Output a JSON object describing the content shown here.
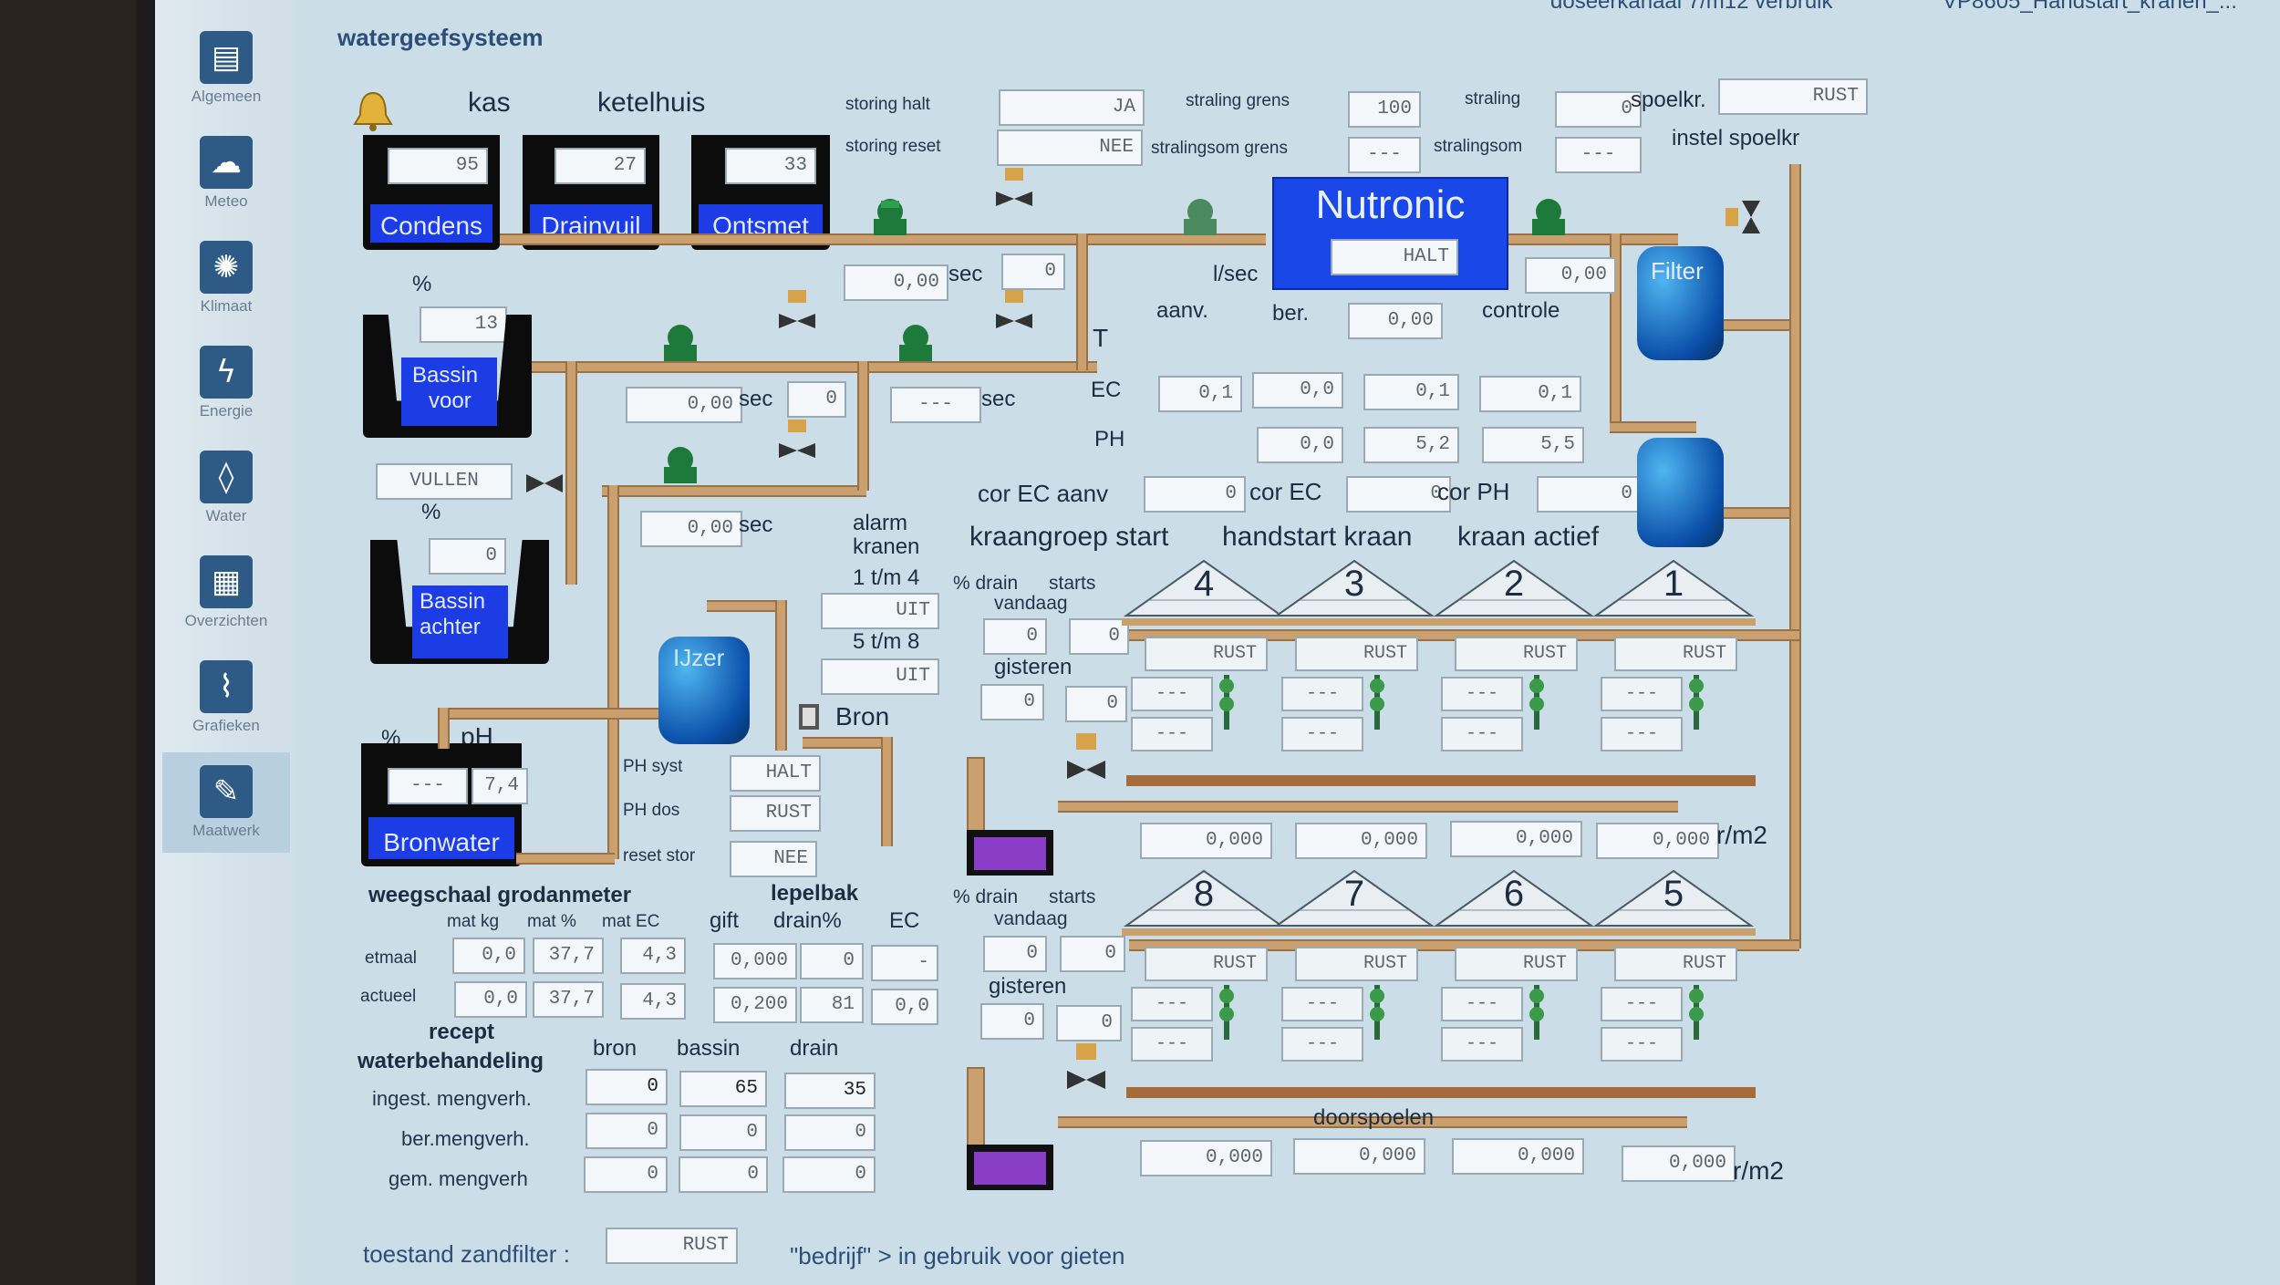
{
  "window": {
    "title": "watergeefsysteem",
    "top_right_text_1": "doseerkanaal 7/m12 verbruik",
    "top_right_text_2": "VP8605_Handstart_kranen_..."
  },
  "sidebar": {
    "items": [
      {
        "label": "Algemeen",
        "icon": "notebook-icon"
      },
      {
        "label": "Meteo",
        "icon": "cloud-icon"
      },
      {
        "label": "Klimaat",
        "icon": "sun-icon"
      },
      {
        "label": "Energie",
        "icon": "lightning-icon"
      },
      {
        "label": "Water",
        "icon": "droplet-icon"
      },
      {
        "label": "Overzichten",
        "icon": "chart-map-icon"
      },
      {
        "label": "Grafieken",
        "icon": "graph-icon"
      },
      {
        "label": "Maatwerk",
        "icon": "pencil-icon"
      }
    ]
  },
  "tanks": {
    "headers": {
      "kas": "kas",
      "ketelhuis": "ketelhuis"
    },
    "condens": {
      "name": "Condens",
      "value": "95"
    },
    "drainvuil": {
      "name": "Drainvuil",
      "value": "27"
    },
    "ontsmet": {
      "name": "Ontsmet",
      "value": "33"
    },
    "bassin_voor": {
      "name_line1": "Bassin",
      "name_line2": "voor",
      "pct_label": "%",
      "value": "13",
      "button": "VULLEN"
    },
    "bassin_achter": {
      "name_line1": "Bassin",
      "name_line2": "achter",
      "pct_label": "%",
      "value": "0"
    },
    "bronwater": {
      "name": "Bronwater",
      "pct_label": "%",
      "ph_label": "pH",
      "value": "---",
      "ph": "7,4"
    }
  },
  "storing": {
    "halt_label": "storing halt",
    "halt_value": "JA",
    "reset_label": "storing reset",
    "reset_value": "NEE"
  },
  "straling": {
    "grens_label": "straling grens",
    "grens_value": "100",
    "straling_label": "straling",
    "straling_value": "0",
    "som_grens_label": "stralingsom grens",
    "som_grens_value": "---",
    "som_label": "stralingsom",
    "som_value": "---",
    "spoelkr_label": "spoelkr.",
    "spoelkr_value": "RUST",
    "instel_label": "instel spoelkr"
  },
  "flows": {
    "f1": "0,00",
    "f1_unit": "sec",
    "f1_b": "0",
    "f2": "0,00",
    "f2_unit": "sec",
    "f2_b": "0",
    "f3": "---",
    "f3_unit": "sec",
    "f4": "0,00",
    "f4_unit": "sec",
    "lsec_label": "l/sec",
    "t_label": "T"
  },
  "nutronic": {
    "title": "Nutronic",
    "status": "HALT",
    "controle_value": "0,00",
    "controle_label": "controle",
    "aanv_label": "aanv.",
    "ber_label": "ber.",
    "ber_value": "0,00",
    "ec_label": "EC",
    "ph_label": "PH",
    "ec_aanv": "0,1",
    "ec_ber": "0,0",
    "ec_v1": "0,1",
    "ec_v2": "0,1",
    "ph_ber": "0,0",
    "ph_v1": "5,2",
    "ph_v2": "5,5",
    "cor_ec_aanv_label": "cor EC aanv",
    "cor_ec_aanv": "0",
    "cor_ec_label": "cor EC",
    "cor_ec": "0",
    "cor_ph_label": "cor PH",
    "cor_ph": "0",
    "filter_label": "Filter"
  },
  "alarm": {
    "label_line1": "alarm",
    "label_line2": "kranen",
    "k14_label": "1 t/m 4",
    "k14_value": "UIT",
    "k58_label": "5 t/m 8",
    "k58_value": "UIT"
  },
  "bron": {
    "ijzer_label": "IJzer",
    "bron_label": "Bron",
    "ph_syst_label": "PH syst",
    "ph_syst_value": "HALT",
    "ph_dos_label": "PH dos",
    "ph_dos_value": "RUST",
    "reset_stor_label": "reset stor",
    "reset_stor_value": "NEE"
  },
  "kraangroep": {
    "headers": {
      "start": "kraangroep start",
      "handstart": "handstart kraan",
      "actief": "kraan actief"
    },
    "top": {
      "drain_label": "% drain",
      "starts_label": "starts",
      "vandaag_label": "vandaag",
      "gisteren_label": "gisteren",
      "drain_vandaag": "0",
      "starts_vandaag": "0",
      "drain_gisteren": "0",
      "starts_gisteren": "0",
      "houses": [
        {
          "num": "4",
          "status": "RUST",
          "r1": "---",
          "r2": "---",
          "total": "0,000"
        },
        {
          "num": "3",
          "status": "RUST",
          "r1": "---",
          "r2": "---",
          "total": "0,000"
        },
        {
          "num": "2",
          "status": "RUST",
          "r1": "---",
          "r2": "---",
          "total": "0,000"
        },
        {
          "num": "1",
          "status": "RUST",
          "r1": "---",
          "r2": "---",
          "total": "0,000"
        }
      ],
      "unit": "r/m2"
    },
    "bottom": {
      "drain_label": "% drain",
      "starts_label": "starts",
      "vandaag_label": "vandaag",
      "gisteren_label": "gisteren",
      "drain_vandaag": "0",
      "starts_vandaag": "0",
      "drain_gisteren": "0",
      "starts_gisteren": "0",
      "houses": [
        {
          "num": "8",
          "status": "RUST",
          "r1": "---",
          "r2": "---",
          "total": "0,000"
        },
        {
          "num": "7",
          "status": "RUST",
          "r1": "---",
          "r2": "---",
          "total": "0,000"
        },
        {
          "num": "6",
          "status": "RUST",
          "r1": "---",
          "r2": "---",
          "total": "0,000"
        },
        {
          "num": "5",
          "status": "RUST",
          "r1": "---",
          "r2": "---",
          "total": "0,000"
        }
      ],
      "unit": "r/m2",
      "doorspoelen_label": "doorspoelen"
    }
  },
  "weegschaal": {
    "title_1": "weegschaal grodanmeter",
    "title_2": "lepelbak",
    "cols": [
      "mat kg",
      "mat %",
      "mat EC",
      "gift",
      "drain%",
      "EC"
    ],
    "rows": [
      {
        "label": "etmaal",
        "values": [
          "0,0",
          "37,7",
          "4,3",
          "0,000",
          "0",
          "-"
        ]
      },
      {
        "label": "actueel",
        "values": [
          "0,0",
          "37,7",
          "4,3",
          "0,200",
          "81",
          "0,0"
        ]
      }
    ]
  },
  "recept": {
    "title_1": "recept",
    "title_2": "waterbehandeling",
    "cols": [
      "bron",
      "bassin",
      "drain"
    ],
    "rows": [
      {
        "label": "ingest. mengverh.",
        "values": [
          "0",
          "65",
          "35"
        ]
      },
      {
        "label": "ber.mengverh.",
        "values": [
          "0",
          "0",
          "0"
        ]
      },
      {
        "label": "gem. mengverh",
        "values": [
          "0",
          "0",
          "0"
        ]
      }
    ]
  },
  "status": {
    "zandfilter_label": "toestand zandfilter :",
    "zandfilter_value": "RUST",
    "bedrijf_text": "\"bedrijf\" >  in gebruik voor gieten"
  },
  "colors": {
    "tank_blue": "#1c3de6",
    "pipe": "#c9a06e",
    "pump_green": "#1e7a3a",
    "background": "#cbdde6"
  }
}
